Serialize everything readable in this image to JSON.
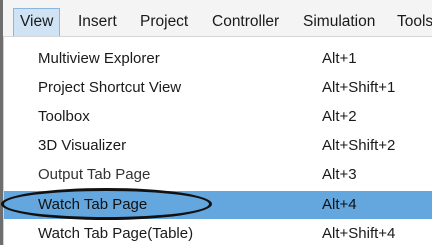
{
  "menubar": {
    "items": [
      {
        "label": "View",
        "active": true
      },
      {
        "label": "Insert"
      },
      {
        "label": "Project"
      },
      {
        "label": "Controller"
      },
      {
        "label": "Simulation"
      },
      {
        "label": "Tools"
      }
    ]
  },
  "menu": {
    "items": [
      {
        "label": "Multiview Explorer",
        "shortcut": "Alt+1"
      },
      {
        "label": "Project Shortcut View",
        "shortcut": "Alt+Shift+1"
      },
      {
        "label": "Toolbox",
        "shortcut": "Alt+2"
      },
      {
        "label": "3D Visualizer",
        "shortcut": "Alt+Shift+2"
      },
      {
        "label": "Output Tab Page",
        "shortcut": "Alt+3"
      },
      {
        "label": "Watch Tab Page",
        "shortcut": "Alt+4",
        "highlighted": true
      },
      {
        "label": "Watch Tab Page(Table)",
        "shortcut": "Alt+Shift+4"
      }
    ]
  },
  "colors": {
    "highlight": "#64a7de",
    "active_menu_bg": "#cfe3f4",
    "menubar_bg": "#f4f4f4"
  }
}
